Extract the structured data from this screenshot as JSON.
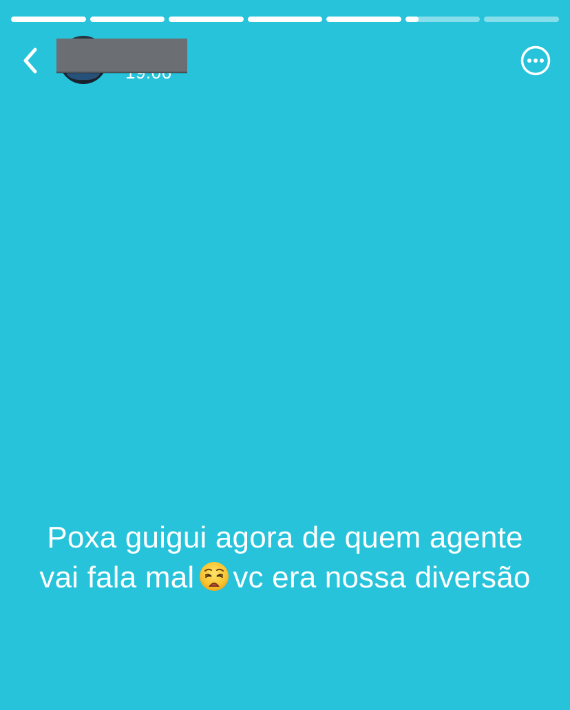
{
  "story": {
    "progress_segments": [
      1,
      1,
      1,
      1,
      1,
      0.18,
      0
    ],
    "timestamp": "19:06",
    "back_icon": "chevron-left-icon",
    "more_icon": "ellipsis-circle-icon",
    "background_color": "#26C3DB"
  },
  "caption": {
    "line1": "Poxa guigui agora de quem agente",
    "line2_start": "vai fala mal",
    "emoji": "weary-face-emoji",
    "line2_end": "vc era nossa diversão"
  }
}
